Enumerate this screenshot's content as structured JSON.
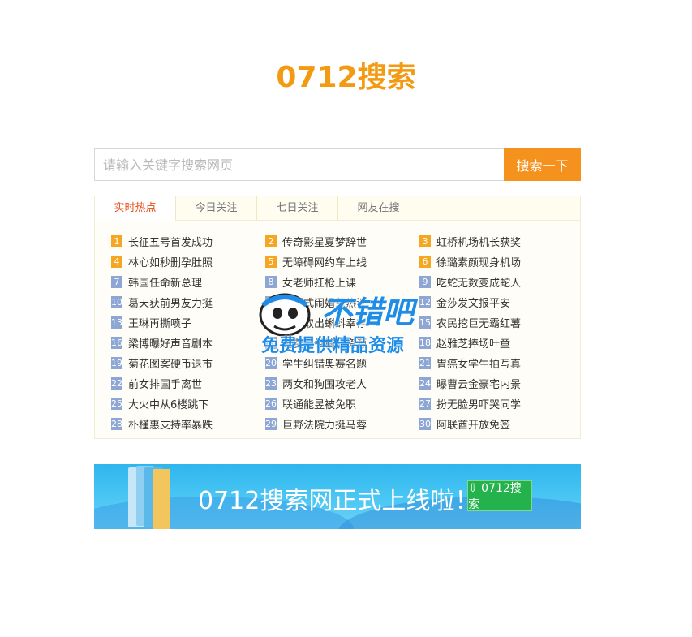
{
  "logo": "0712搜索",
  "search": {
    "placeholder": "请输入关键字搜索网页",
    "button": "搜索一下"
  },
  "tabs": [
    "实时热点",
    "今日关注",
    "七日关注",
    "网友在搜"
  ],
  "hot_items": [
    {
      "rank": "1",
      "text": "长征五号首发成功"
    },
    {
      "rank": "2",
      "text": "传奇影星夏梦辞世"
    },
    {
      "rank": "3",
      "text": "虹桥机场机长获奖"
    },
    {
      "rank": "4",
      "text": "林心如秒删孕肚照"
    },
    {
      "rank": "5",
      "text": "无障碍网约车上线"
    },
    {
      "rank": "6",
      "text": "徐璐素颜现身机场"
    },
    {
      "rank": "7",
      "text": "韩国任命新总理"
    },
    {
      "rank": "8",
      "text": "女老师扛枪上课"
    },
    {
      "rank": "9",
      "text": "吃蛇无数变成蛇人"
    },
    {
      "rank": "10",
      "text": "葛天获前男友力挺"
    },
    {
      "rank": "11",
      "text": "中国式闹婚惹热议"
    },
    {
      "rank": "12",
      "text": "金莎发文报平安"
    },
    {
      "rank": "13",
      "text": "王琳再撕喷子"
    },
    {
      "rank": "14",
      "text": "母手取出蝌蚪幸存"
    },
    {
      "rank": "15",
      "text": "农民挖巨无霸红薯"
    },
    {
      "rank": "16",
      "text": "梁博曝好声音剧本"
    },
    {
      "rank": "17",
      "text": "免费提供精品资源"
    },
    {
      "rank": "18",
      "text": "赵雅芝捧场叶童"
    },
    {
      "rank": "19",
      "text": "菊花图案硬币退市"
    },
    {
      "rank": "20",
      "text": "学生纠错奥赛名题"
    },
    {
      "rank": "21",
      "text": "胃癌女学生拍写真"
    },
    {
      "rank": "22",
      "text": "前女排国手离世"
    },
    {
      "rank": "23",
      "text": "两女和狗围攻老人"
    },
    {
      "rank": "24",
      "text": "曝曹云金豪宅内景"
    },
    {
      "rank": "25",
      "text": "大火中从6楼跳下"
    },
    {
      "rank": "26",
      "text": "联通能昱被免职"
    },
    {
      "rank": "27",
      "text": "扮无脸男吓哭同学"
    },
    {
      "rank": "28",
      "text": "朴槿惠支持率暴跌"
    },
    {
      "rank": "29",
      "text": "巨野法院力挺马蓉"
    },
    {
      "rank": "30",
      "text": "阿联酋开放免签"
    }
  ],
  "banner": {
    "text": "0712搜索网正式上线啦！！！",
    "button": "⇩ 0712搜索"
  },
  "watermark": {
    "title": "不错吧",
    "subtitle": "免费提供精品资源"
  },
  "colors": {
    "brand": "#f29b12",
    "search_button": "#f5921e",
    "active_tab": "#e64d16",
    "rank_top": "#f5a623",
    "rank_rest": "#8da6d3"
  }
}
